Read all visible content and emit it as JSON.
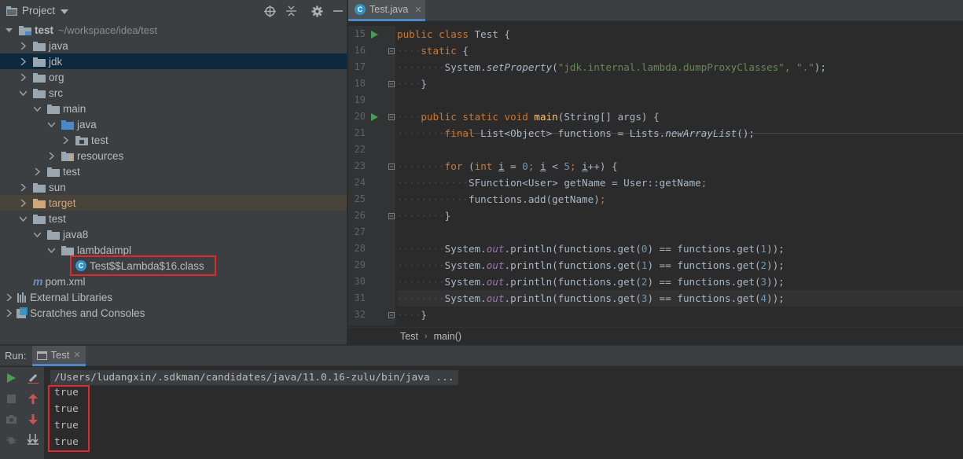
{
  "project_panel": {
    "title": "Project",
    "tree": [
      {
        "label": "test",
        "hint": "~/workspace/idea/test",
        "bold": true
      },
      {
        "label": "java"
      },
      {
        "label": "jdk"
      },
      {
        "label": "org"
      },
      {
        "label": "src"
      },
      {
        "label": "main"
      },
      {
        "label": "java"
      },
      {
        "label": "test"
      },
      {
        "label": "resources"
      },
      {
        "label": "test"
      },
      {
        "label": "sun"
      },
      {
        "label": "target"
      },
      {
        "label": "test"
      },
      {
        "label": "java8"
      },
      {
        "label": "lambdaimpl"
      },
      {
        "label": "Test$$Lambda$16.class"
      },
      {
        "label": "pom.xml"
      },
      {
        "label": "External Libraries"
      },
      {
        "label": "Scratches and Consoles"
      }
    ]
  },
  "editor": {
    "tab_label": "Test.java",
    "line_numbers": [
      "15",
      "16",
      "17",
      "18",
      "19",
      "20",
      "21",
      "22",
      "23",
      "24",
      "25",
      "26",
      "27",
      "28",
      "29",
      "30",
      "31",
      "32"
    ],
    "breadcrumb": [
      "Test",
      "main()"
    ]
  },
  "code": {
    "l15": [
      "public class ",
      "Test",
      " {"
    ],
    "l16": [
      "static",
      " {"
    ],
    "l17": [
      "System.",
      "setProperty",
      "(",
      "\"jdk.internal.lambda.dumpProxyClasses\"",
      ", ",
      "\".\"",
      ");"
    ],
    "l18": [
      "}"
    ],
    "l20": [
      "public static void ",
      "main",
      "(String[] args) {"
    ],
    "l21": [
      "final ",
      "List",
      "<",
      "Object",
      "> functions = Lists.",
      "newArrayList",
      "();"
    ],
    "l23": [
      "for ",
      "(",
      "int ",
      "i",
      " = ",
      "0",
      "; ",
      "i",
      " < ",
      "5",
      "; ",
      "i",
      "++) {"
    ],
    "l24": [
      "SFunction",
      "<",
      "User",
      "> getName = User::getName",
      ";"
    ],
    "l25": [
      "functions.add(getName)",
      ";"
    ],
    "l26": [
      "}"
    ],
    "l28": [
      "System.",
      "out",
      ".println(functions.get(",
      "0",
      ") == functions.get(",
      "1",
      "));"
    ],
    "l29": [
      "System.",
      "out",
      ".println(functions.get(",
      "1",
      ") == functions.get(",
      "2",
      "));"
    ],
    "l30": [
      "System.",
      "out",
      ".println(functions.get(",
      "2",
      ") == functions.get(",
      "3",
      "));"
    ],
    "l31": [
      "System.",
      "out",
      ".println(functions.get(",
      "3",
      ") == functions.get(",
      "4",
      "));"
    ],
    "l32": [
      "}"
    ]
  },
  "run_panel": {
    "label": "Run:",
    "tab_label": "Test",
    "command": "/Users/ludangxin/.sdkman/candidates/java/11.0.16-zulu/bin/java ...",
    "output": [
      "true",
      "true",
      "true",
      "true"
    ]
  },
  "colors": {
    "accent": "#4a88c7",
    "highlight_box": "#e0282e",
    "keyword": "#cc7832",
    "string": "#6a8759",
    "number": "#6897bb"
  }
}
